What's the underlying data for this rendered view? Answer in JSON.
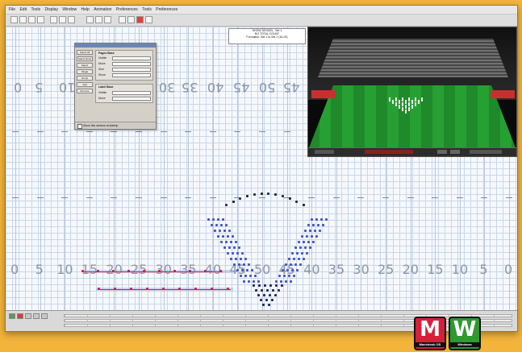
{
  "menubar": {
    "items": [
      "File",
      "Edit",
      "Tools",
      "Display",
      "Window",
      "Help",
      "Animation",
      "Preferences",
      "Tools",
      "Preferences"
    ]
  },
  "infobox": {
    "line1": "SHOW DESIGN - Set 1",
    "line2": "NO TOTAL COUNT",
    "line3": "Formation: Set 1 to Set 2 (16-24)"
  },
  "dialog": {
    "side_buttons": [
      "Select All",
      "Select None",
      "Select",
      "Single",
      "Group",
      "Add",
      "Remove"
    ],
    "group1_title": "Pages Base",
    "group1_fields": [
      "Visible",
      "Move",
      "Size",
      "Show"
    ],
    "group2_title": "Label Base",
    "group2_fields": [
      "Visible",
      "Move"
    ],
    "footer_label": "Show this window at startup"
  },
  "field_numbers_top": [
    "0",
    "5",
    "10",
    "30",
    "35",
    "40",
    "45",
    "50",
    "45"
  ],
  "field_numbers_bottom": [
    "0",
    "5",
    "10",
    "15",
    "20",
    "25",
    "30",
    "35",
    "40",
    "45",
    "50",
    "45",
    "40",
    "35",
    "30",
    "25",
    "20",
    "15",
    "10",
    "5",
    "0"
  ],
  "badges": [
    {
      "letter": "M",
      "caption": "Macintosh OS",
      "color": "#d6203a"
    },
    {
      "letter": "W",
      "caption": "Windows",
      "color": "#2f9a2f"
    }
  ]
}
